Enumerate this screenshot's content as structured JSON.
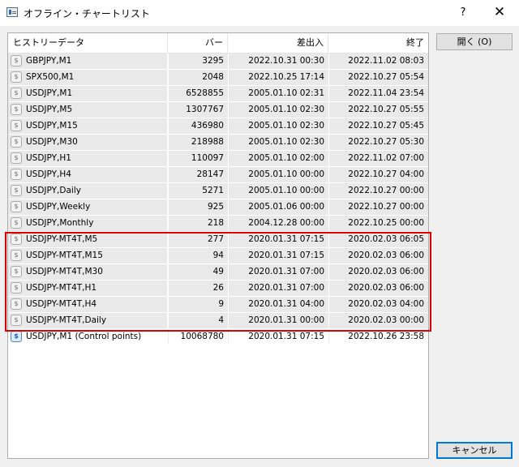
{
  "window": {
    "title": "オフライン・チャートリスト",
    "help": "?",
    "close": "✕"
  },
  "columns": [
    "ヒストリーデータ",
    "バー",
    "差出入",
    "終了"
  ],
  "rows": [
    {
      "name": "GBPJPY,M1",
      "bars": "3295",
      "start": "2022.10.31 00:30",
      "end": "2022.11.02 08:03",
      "icon": "dollar-icon"
    },
    {
      "name": "SPX500,M1",
      "bars": "2048",
      "start": "2022.10.25 17:14",
      "end": "2022.10.27 05:54",
      "icon": "dollar-icon"
    },
    {
      "name": "USDJPY,M1",
      "bars": "6528855",
      "start": "2005.01.10 02:31",
      "end": "2022.11.04 23:54",
      "icon": "dollar-icon"
    },
    {
      "name": "USDJPY,M5",
      "bars": "1307767",
      "start": "2005.01.10 02:30",
      "end": "2022.10.27 05:55",
      "icon": "dollar-icon"
    },
    {
      "name": "USDJPY,M15",
      "bars": "436980",
      "start": "2005.01.10 02:30",
      "end": "2022.10.27 05:45",
      "icon": "dollar-icon"
    },
    {
      "name": "USDJPY,M30",
      "bars": "218988",
      "start": "2005.01.10 02:30",
      "end": "2022.10.27 05:30",
      "icon": "dollar-icon"
    },
    {
      "name": "USDJPY,H1",
      "bars": "110097",
      "start": "2005.01.10 02:00",
      "end": "2022.11.02 07:00",
      "icon": "dollar-icon"
    },
    {
      "name": "USDJPY,H4",
      "bars": "28147",
      "start": "2005.01.10 00:00",
      "end": "2022.10.27 04:00",
      "icon": "dollar-icon"
    },
    {
      "name": "USDJPY,Daily",
      "bars": "5271",
      "start": "2005.01.10 00:00",
      "end": "2022.10.27 00:00",
      "icon": "dollar-icon"
    },
    {
      "name": "USDJPY,Weekly",
      "bars": "925",
      "start": "2005.01.06 00:00",
      "end": "2022.10.27 00:00",
      "icon": "dollar-icon"
    },
    {
      "name": "USDJPY,Monthly",
      "bars": "218",
      "start": "2004.12.28 00:00",
      "end": "2022.10.25 00:00",
      "icon": "dollar-icon"
    },
    {
      "name": "USDJPY-MT4T,M5",
      "bars": "277",
      "start": "2020.01.31 07:15",
      "end": "2020.02.03 06:05",
      "icon": "dollar-icon"
    },
    {
      "name": "USDJPY-MT4T,M15",
      "bars": "94",
      "start": "2020.01.31 07:15",
      "end": "2020.02.03 06:00",
      "icon": "dollar-icon"
    },
    {
      "name": "USDJPY-MT4T,M30",
      "bars": "49",
      "start": "2020.01.31 07:00",
      "end": "2020.02.03 06:00",
      "icon": "dollar-icon"
    },
    {
      "name": "USDJPY-MT4T,H1",
      "bars": "26",
      "start": "2020.01.31 07:00",
      "end": "2020.02.03 06:00",
      "icon": "dollar-icon"
    },
    {
      "name": "USDJPY-MT4T,H4",
      "bars": "9",
      "start": "2020.01.31 04:00",
      "end": "2020.02.03 04:00",
      "icon": "dollar-icon"
    },
    {
      "name": "USDJPY-MT4T,Daily",
      "bars": "4",
      "start": "2020.01.31 00:00",
      "end": "2020.02.03 00:00",
      "icon": "dollar-icon"
    },
    {
      "name": "USDJPY,M1 (Control points)",
      "bars": "10068780",
      "start": "2020.01.31 07:15",
      "end": "2022.10.26 23:58",
      "icon": "blue-dollar-icon"
    }
  ],
  "buttons": {
    "open": "開く (O)",
    "cancel": "キャンセル"
  },
  "colors": {
    "highlight": "#e00000",
    "row_alt": "#e9e9e9"
  }
}
